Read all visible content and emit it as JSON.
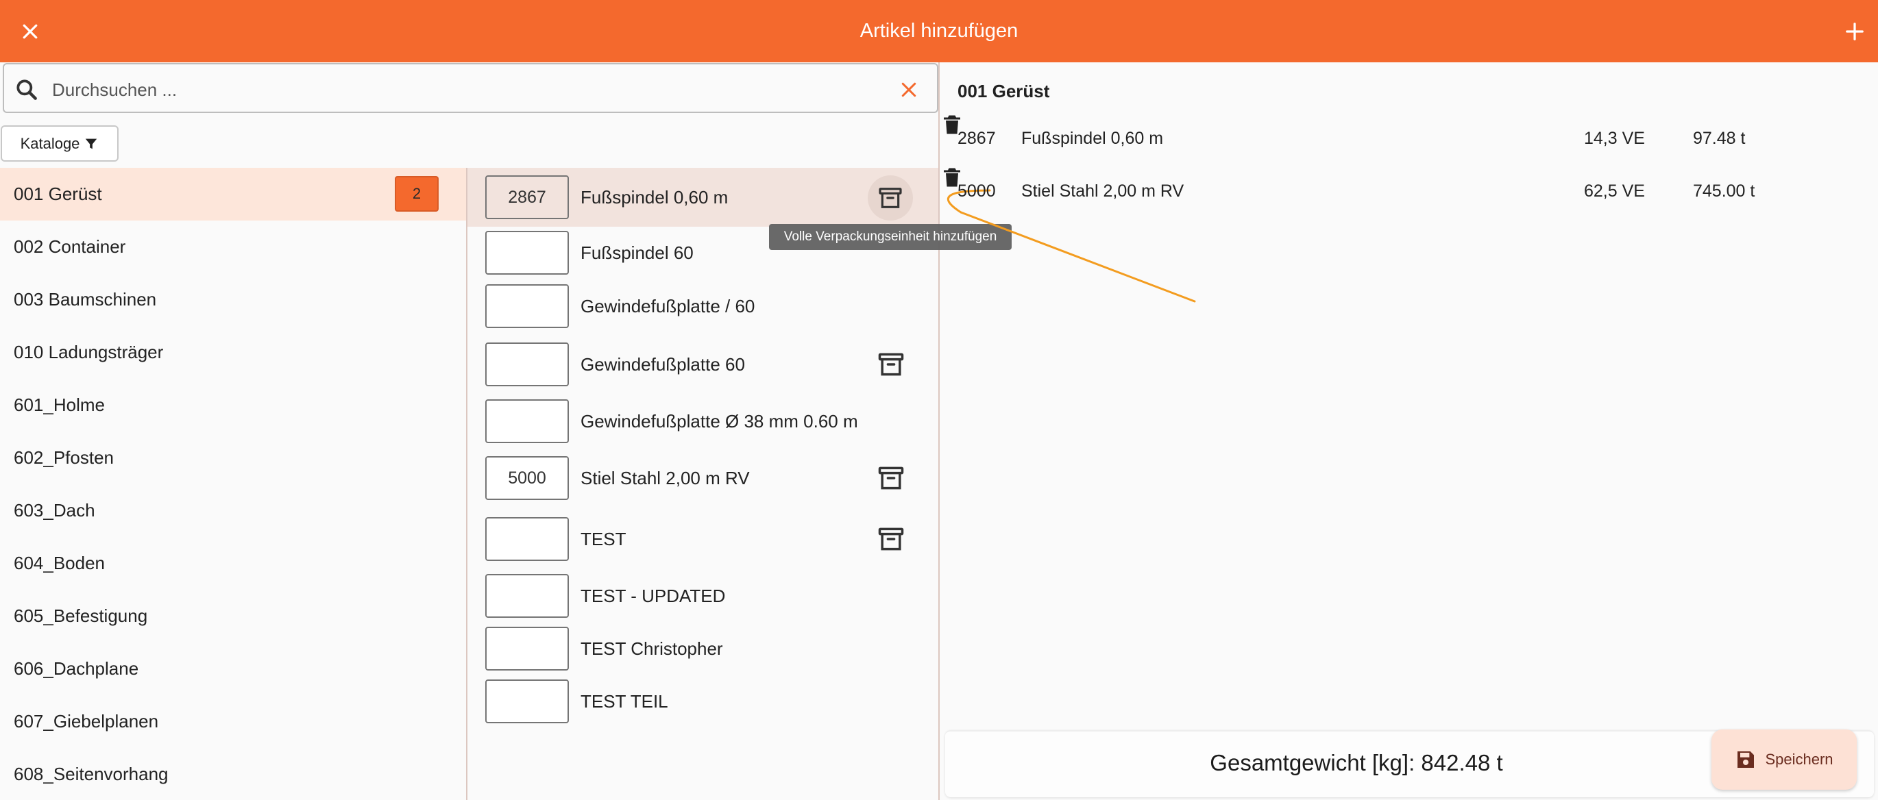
{
  "appbar": {
    "title": "Artikel hinzufügen"
  },
  "search": {
    "placeholder": "Durchsuchen ..."
  },
  "catalog_button": {
    "label": "Kataloge"
  },
  "categories": [
    {
      "label": "001 Gerüst",
      "badge": "2",
      "selected": true
    },
    {
      "label": "002 Container"
    },
    {
      "label": "003 Baumschinen"
    },
    {
      "label": "010 Ladungsträger"
    },
    {
      "label": "601_Holme"
    },
    {
      "label": "602_Pfosten"
    },
    {
      "label": "603_Dach"
    },
    {
      "label": "604_Boden"
    },
    {
      "label": "605_Befestigung"
    },
    {
      "label": "606_Dachplane"
    },
    {
      "label": "607_Giebelplanen"
    },
    {
      "label": "608_Seitenvorhang"
    }
  ],
  "articles": [
    {
      "qty": "2867",
      "name": "Fußspindel 0,60 m",
      "pack_icon": true,
      "selected": true
    },
    {
      "qty": "",
      "name": "Fußspindel 60",
      "pack_icon": false
    },
    {
      "qty": "",
      "name": "Gewindefußplatte / 60",
      "pack_icon": false
    },
    {
      "qty": "",
      "name": "Gewindefußplatte 60",
      "pack_icon": true
    },
    {
      "qty": "",
      "name": "Gewindefußplatte Ø 38 mm 0.60 m",
      "pack_icon": false
    },
    {
      "qty": "5000",
      "name": "Stiel Stahl 2,00 m RV",
      "pack_icon": true
    },
    {
      "qty": "",
      "name": "TEST",
      "pack_icon": true
    },
    {
      "qty": "",
      "name": "TEST - UPDATED",
      "pack_icon": false
    },
    {
      "qty": "",
      "name": "TEST Christopher",
      "pack_icon": false
    },
    {
      "qty": "",
      "name": "TEST TEIL",
      "pack_icon": false
    }
  ],
  "tooltip": {
    "text": "Volle Verpackungseinheit hinzufügen"
  },
  "cart": {
    "group_title": "001 Gerüst",
    "lines": [
      {
        "number": "2867",
        "name": "Fußspindel 0,60 m",
        "ve": "14,3 VE",
        "weight": "97.48 t"
      },
      {
        "number": "5000",
        "name": "Stiel Stahl 2,00 m RV",
        "ve": "62,5 VE",
        "weight": "745.00 t"
      }
    ],
    "total": "Gesamtgewicht [kg]: 842.48 t"
  },
  "save_button": {
    "label": "Speichern"
  },
  "colors": {
    "primary": "#f4692d",
    "selected_bg": "#fde6da",
    "annotation": "#f39c1f"
  },
  "icons": {
    "close": "close-icon",
    "add": "plus-icon",
    "search": "search-icon",
    "clear": "clear-icon",
    "filter": "filter-icon",
    "package": "archive-box-icon",
    "delete": "trash-icon",
    "save": "floppy-disk-icon"
  }
}
